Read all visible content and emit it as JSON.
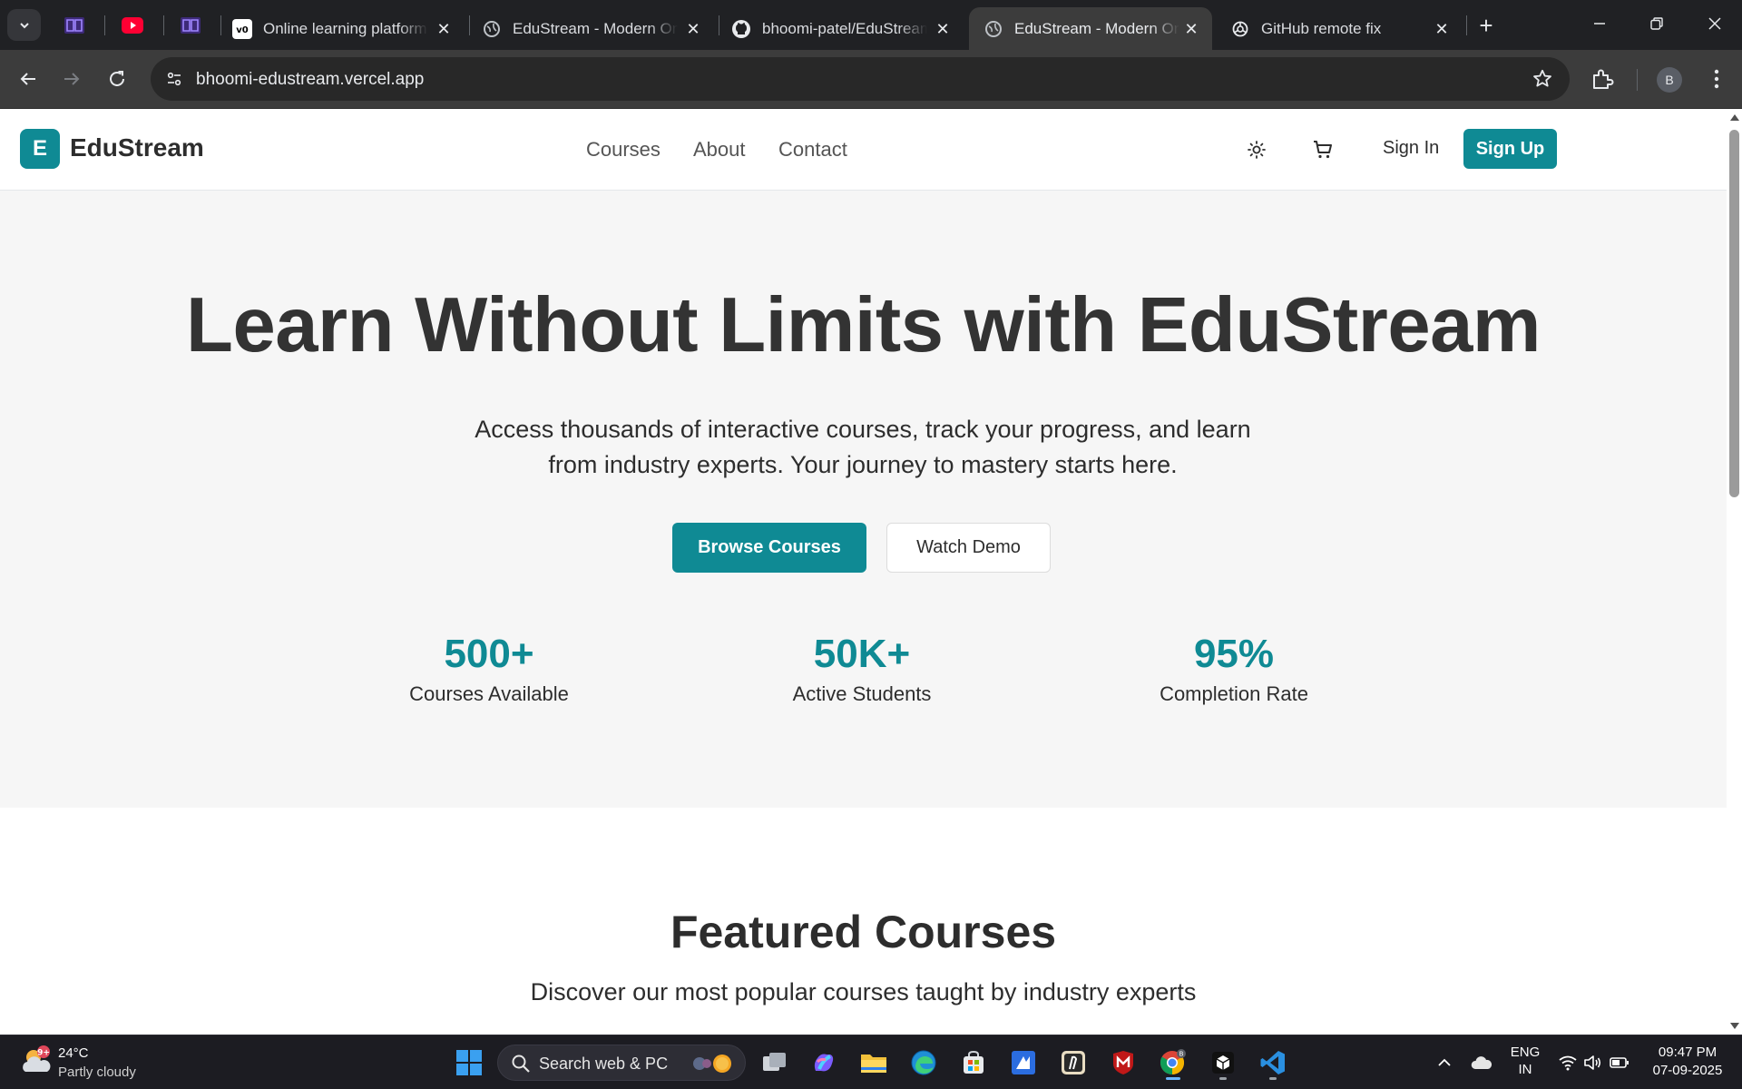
{
  "browser": {
    "tabs": [
      {
        "title": "Online learning platform",
        "favicon": "v0-logo-icon",
        "active": false
      },
      {
        "title": "EduStream - Modern Online",
        "favicon": "globe-icon",
        "active": false
      },
      {
        "title": "bhoomi-patel/EduStream",
        "favicon": "github-icon",
        "active": false
      },
      {
        "title": "EduStream - Modern Online",
        "favicon": "globe-icon",
        "active": true
      },
      {
        "title": "GitHub remote fix",
        "favicon": "chatgpt-icon",
        "active": false
      }
    ],
    "url": "bhoomi-edustream.vercel.app",
    "profile_initial": "B"
  },
  "site": {
    "logo_letter": "E",
    "logo_text": "EduStream",
    "nav": [
      "Courses",
      "About",
      "Contact"
    ],
    "sign_in": "Sign In",
    "sign_up": "Sign Up",
    "brand_color": "#0f8a94"
  },
  "hero": {
    "title": "Learn Without Limits with EduStream",
    "subtitle": "Access thousands of interactive courses, track your progress, and learn from industry experts. Your journey to mastery starts here.",
    "primary_cta": "Browse Courses",
    "secondary_cta": "Watch Demo",
    "stats": [
      {
        "value": "500+",
        "label": "Courses Available"
      },
      {
        "value": "50K+",
        "label": "Active Students"
      },
      {
        "value": "95%",
        "label": "Completion Rate"
      }
    ]
  },
  "featured": {
    "title": "Featured Courses",
    "subtitle": "Discover our most popular courses taught by industry experts"
  },
  "taskbar": {
    "weather_temp": "24°C",
    "weather_desc": "Partly cloudy",
    "weather_badge": "9+",
    "search_placeholder": "Search web & PC",
    "lang_line1": "ENG",
    "lang_line2": "IN",
    "time": "09:47 PM",
    "date": "07-09-2025"
  }
}
